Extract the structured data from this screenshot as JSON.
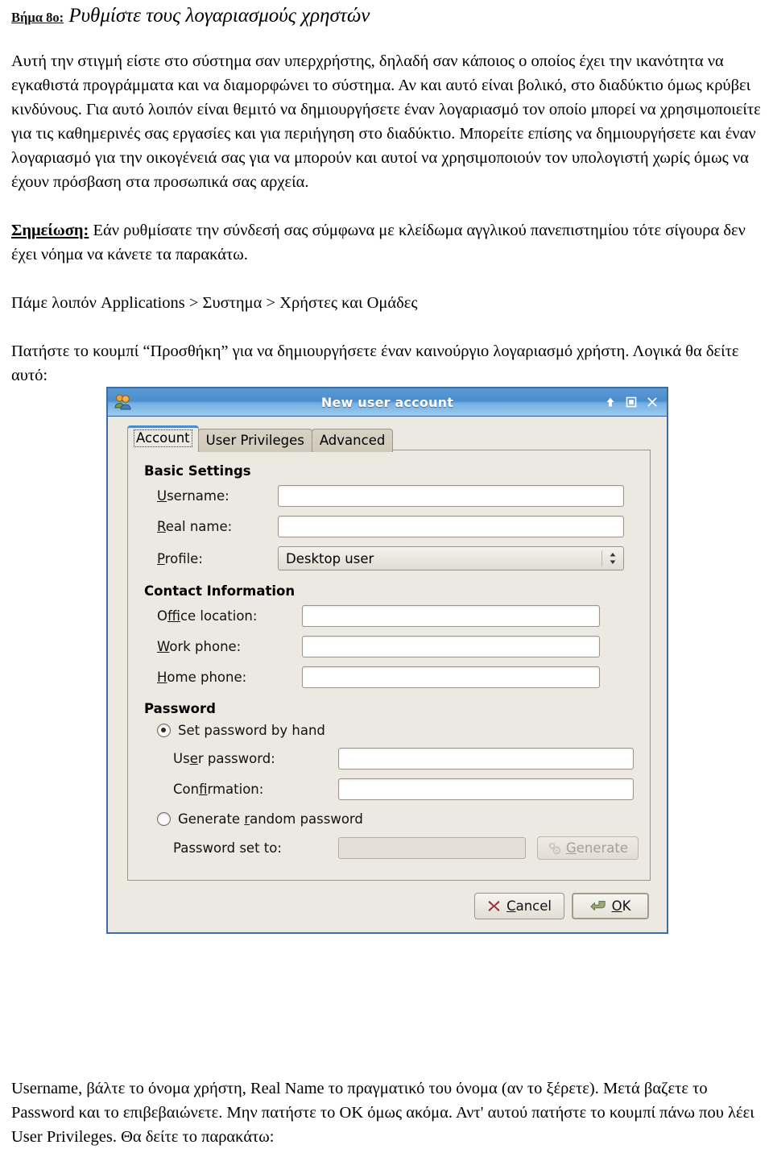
{
  "document": {
    "step_label": "Βήμα 8ο:",
    "step_title": "Ρυθμίστε τους λογαριασμούς χρηστών",
    "para1": "Αυτή την στιγμή είστε στο σύστημα σαν υπερχρήστης, δηλαδή σαν κάποιος ο οποίος έχει την ικανότητα να εγκαθιστά προγράμματα και να διαμορφώνει το σύστημα. Αν και αυτό είναι βολικό, στο διαδύκτιο όμως κρύβει κινδύνους. Για αυτό λοιπόν είναι θεμιτό να δημιουργήσετε έναν λογαριασμό τον οποίο μπορεί να χρησιμοποιείτε για τις καθημερινές σας εργασίες και για περιήγηση στο διαδύκτιο. Μπορείτε επίσης να δημιουργήσετε και έναν λογαριασμό για την οικογένειά σας για να μπορούν και αυτοί να χρησιμοποιούν τον υπολογιστή χωρίς όμως να έχουν πρόσβαση στα προσωπικά σας αρχεία.",
    "note_label": "Σημείωση:",
    "note_text": " Εάν ρυθμίσατε την σύνδεσή σας σύμφωνα με κλείδωμα αγγλικού πανεπιστημίου τότε σίγουρα δεν έχει νόημα να κάνετε τα παρακάτω.",
    "para_path": "Πάμε λοιπόν Applications > Συστημα > Χρήστες και Ομάδες",
    "para_click": "Πατήστε το κουμπί “Προσθήκη” για να δημιουργήσετε έναν καινούργιο λογαριασμό χρήστη. Λογικά θα δείτε αυτό:",
    "para_after": "Username, βάλτε το όνομα χρήστη, Real Name το πραγματικό του όνομα (αν το ξέρετε). Μετά βαζετε το Password και το επιβεβαιώνετε. Μην πατήστε το ΟΚ όμως ακόμα. Αντ' αυτού πατήστε το κουμπί πάνω που λέει User Privileges. Θα δείτε το παρακάτω:"
  },
  "dialog": {
    "title": "New user account",
    "window_icon": "users-icon",
    "titlebar_buttons": [
      {
        "name": "shade-button",
        "glyph": "↑"
      },
      {
        "name": "maximize-button",
        "glyph": "□"
      },
      {
        "name": "close-button",
        "glyph": "✕"
      }
    ],
    "tabs": [
      {
        "label": "Account",
        "active": true
      },
      {
        "label": "User Privileges",
        "active": false
      },
      {
        "label": "Advanced",
        "active": false
      }
    ],
    "sections": {
      "basic": {
        "title": "Basic Settings",
        "username_label": "Username:",
        "username_value": "",
        "realname_label": "Real name:",
        "realname_value": "",
        "profile_label": "Profile:",
        "profile_value": "Desktop user",
        "profile_options": [
          "Desktop user"
        ]
      },
      "contact": {
        "title": "Contact Information",
        "office_label": "Office location:",
        "office_value": "",
        "work_label": "Work phone:",
        "work_value": "",
        "home_label": "Home phone:",
        "home_value": ""
      },
      "password": {
        "title": "Password",
        "radio_manual": "Set password by hand",
        "radio_manual_selected": true,
        "user_password_label": "User password:",
        "user_password_value": "",
        "confirmation_label": "Confirmation:",
        "confirmation_value": "",
        "radio_random": "Generate random password",
        "radio_random_selected": false,
        "password_set_to_label": "Password set to:",
        "password_set_to_value": "",
        "generate_button": "Generate",
        "generate_enabled": false
      }
    },
    "buttons": {
      "cancel": "Cancel",
      "ok": "OK"
    },
    "colors": {
      "titlebar_blue": "#4a8ccc",
      "window_border": "#3c6ea5",
      "dialog_bg": "#ece9e2",
      "active_tab_accent": "#4a8ccc",
      "cancel_icon": "#9e2b3a",
      "ok_icon": "#8c9a6b"
    }
  }
}
